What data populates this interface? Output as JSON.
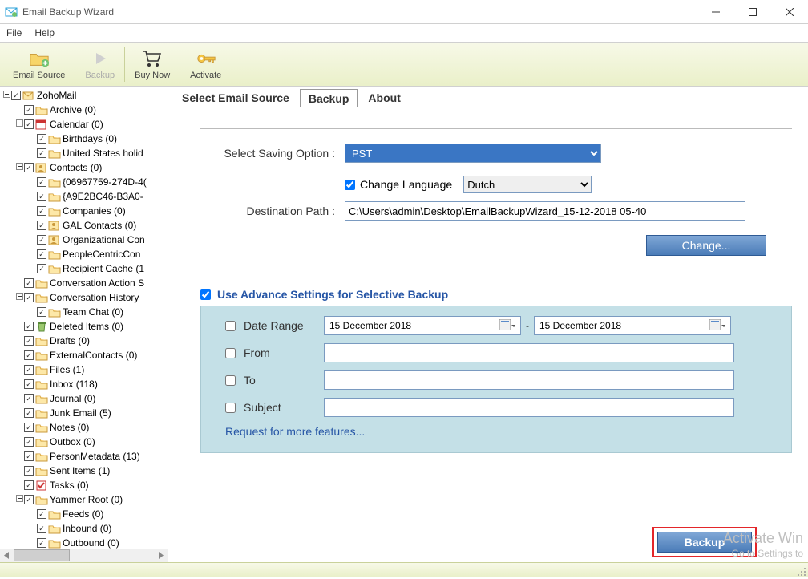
{
  "window": {
    "title": "Email Backup Wizard"
  },
  "menu": {
    "file": "File",
    "help": "Help"
  },
  "toolbar": {
    "email_source": "Email Source",
    "backup": "Backup",
    "buy_now": "Buy Now",
    "activate": "Activate"
  },
  "tree": {
    "root": "ZohoMail",
    "items": [
      {
        "indent": 0,
        "exp": "-",
        "label": "ZohoMail",
        "icon": "mailbox"
      },
      {
        "indent": 1,
        "exp": "",
        "label": "Archive (0)",
        "icon": "folder"
      },
      {
        "indent": 1,
        "exp": "-",
        "label": "Calendar (0)",
        "icon": "calendar"
      },
      {
        "indent": 2,
        "exp": "",
        "label": "Birthdays (0)",
        "icon": "folder"
      },
      {
        "indent": 2,
        "exp": "",
        "label": "United States holid",
        "icon": "folder"
      },
      {
        "indent": 1,
        "exp": "-",
        "label": "Contacts (0)",
        "icon": "contacts"
      },
      {
        "indent": 2,
        "exp": "",
        "label": "{06967759-274D-4(",
        "icon": "folder"
      },
      {
        "indent": 2,
        "exp": "",
        "label": "{A9E2BC46-B3A0-",
        "icon": "folder"
      },
      {
        "indent": 2,
        "exp": "",
        "label": "Companies (0)",
        "icon": "folder"
      },
      {
        "indent": 2,
        "exp": "",
        "label": "GAL Contacts (0)",
        "icon": "contacts"
      },
      {
        "indent": 2,
        "exp": "",
        "label": "Organizational Con",
        "icon": "contacts"
      },
      {
        "indent": 2,
        "exp": "",
        "label": "PeopleCentricCon",
        "icon": "folder"
      },
      {
        "indent": 2,
        "exp": "",
        "label": "Recipient Cache (1",
        "icon": "folder"
      },
      {
        "indent": 1,
        "exp": "",
        "label": "Conversation Action S",
        "icon": "folder"
      },
      {
        "indent": 1,
        "exp": "-",
        "label": "Conversation History",
        "icon": "folder"
      },
      {
        "indent": 2,
        "exp": "",
        "label": "Team Chat (0)",
        "icon": "folder"
      },
      {
        "indent": 1,
        "exp": "",
        "label": "Deleted Items (0)",
        "icon": "trash"
      },
      {
        "indent": 1,
        "exp": "",
        "label": "Drafts (0)",
        "icon": "folder"
      },
      {
        "indent": 1,
        "exp": "",
        "label": "ExternalContacts (0)",
        "icon": "folder"
      },
      {
        "indent": 1,
        "exp": "",
        "label": "Files (1)",
        "icon": "folder"
      },
      {
        "indent": 1,
        "exp": "",
        "label": "Inbox (118)",
        "icon": "folder"
      },
      {
        "indent": 1,
        "exp": "",
        "label": "Journal (0)",
        "icon": "folder"
      },
      {
        "indent": 1,
        "exp": "",
        "label": "Junk Email (5)",
        "icon": "folder"
      },
      {
        "indent": 1,
        "exp": "",
        "label": "Notes (0)",
        "icon": "folder"
      },
      {
        "indent": 1,
        "exp": "",
        "label": "Outbox (0)",
        "icon": "folder"
      },
      {
        "indent": 1,
        "exp": "",
        "label": "PersonMetadata (13)",
        "icon": "folder"
      },
      {
        "indent": 1,
        "exp": "",
        "label": "Sent Items (1)",
        "icon": "folder"
      },
      {
        "indent": 1,
        "exp": "",
        "label": "Tasks (0)",
        "icon": "tasks"
      },
      {
        "indent": 1,
        "exp": "-",
        "label": "Yammer Root (0)",
        "icon": "folder"
      },
      {
        "indent": 2,
        "exp": "",
        "label": "Feeds (0)",
        "icon": "folder"
      },
      {
        "indent": 2,
        "exp": "",
        "label": "Inbound (0)",
        "icon": "folder"
      },
      {
        "indent": 2,
        "exp": "",
        "label": "Outbound (0)",
        "icon": "folder"
      }
    ]
  },
  "tabs": {
    "select_email_source": "Select Email Source",
    "backup": "Backup",
    "about": "About"
  },
  "form": {
    "saving_option_label": "Select Saving Option :",
    "saving_option_value": "PST",
    "change_language_label": "Change Language",
    "language_value": "Dutch",
    "destination_path_label": "Destination Path :",
    "destination_path_value": "C:\\Users\\admin\\Desktop\\EmailBackupWizard_15-12-2018 05-40",
    "change_button": "Change..."
  },
  "advance": {
    "header": "Use Advance Settings for Selective Backup",
    "date_range": "Date Range",
    "date_from_value": "15  December  2018",
    "date_to_value": "15  December  2018",
    "from": "From",
    "to": "To",
    "subject": "Subject",
    "request_link": "Request for more features..."
  },
  "backup_button": "Backup",
  "watermark": {
    "line1": "Activate Win",
    "line2": "Go to Settings to"
  }
}
